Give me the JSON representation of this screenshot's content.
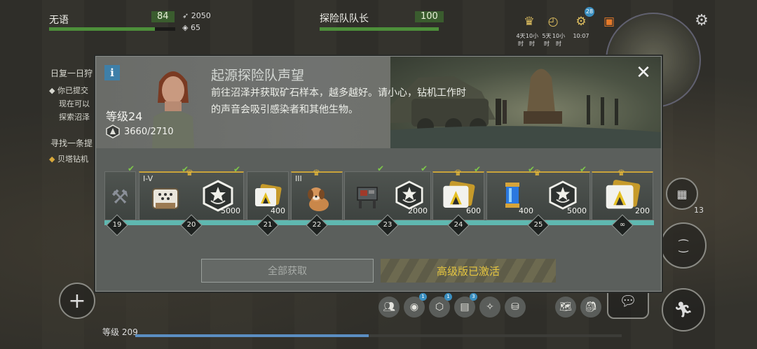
{
  "player": {
    "name": "无语",
    "hp": "84",
    "weapon_stat": "2050",
    "armor_stat": "65"
  },
  "squad": {
    "label": "探险队队长",
    "hp": "100"
  },
  "top_timers": [
    {
      "icon": "crown-icon",
      "label": "4天\n时"
    },
    {
      "icon": "clock-icon",
      "label": "10小\n时"
    },
    {
      "icon": "gear-badge-icon",
      "label": "5天\n时",
      "badge": "28"
    },
    {
      "icon": "chest-icon",
      "label": "10小\n时"
    },
    {
      "icon": "timer-icon",
      "label": "10:07"
    }
  ],
  "quests": {
    "daily_title": "日复一日狩",
    "daily_lines": [
      "你已提交",
      "现在可以",
      "探索沼泽"
    ],
    "find_title": "寻找一条提",
    "find_line": "贝塔钻机"
  },
  "modal": {
    "info": "i",
    "close": "✕",
    "title": "起源探险队声望",
    "description": "前往沼泽并获取矿石样本，越多越好。请小心，钻机工作时的声音会吸引感染者和其他生物。",
    "level": "等级24",
    "progress": "3660/2710",
    "claim_all": "全部获取",
    "premium_status": "高级版已激活"
  },
  "rewards": [
    {
      "level": "19",
      "item": "weapon-parts-icon",
      "count": "",
      "tier": "",
      "premium": false
    },
    {
      "level": "20",
      "item": "reward-crate-icon",
      "count": "",
      "tier": "I-V",
      "premium": true
    },
    {
      "level": "20",
      "item": "reputation-badge-icon",
      "count": "5000",
      "tier": "",
      "premium": true
    },
    {
      "level": "21",
      "item": "gold-card-icon",
      "count": "400",
      "tier": "",
      "premium": false
    },
    {
      "level": "22",
      "item": "dog-icon",
      "count": "",
      "tier": "III",
      "premium": true
    },
    {
      "level": "23",
      "item": "workbench-icon",
      "count": "",
      "tier": "",
      "premium": false
    },
    {
      "level": "23",
      "item": "reputation-badge-icon",
      "count": "2000",
      "tier": "",
      "premium": false
    },
    {
      "level": "24",
      "item": "gold-card-icon",
      "count": "600",
      "tier": "",
      "premium": true
    },
    {
      "level": "25",
      "item": "energy-capsule-icon",
      "count": "400",
      "tier": "",
      "premium": true
    },
    {
      "level": "25",
      "item": "reputation-badge-icon",
      "count": "5000",
      "tier": "",
      "premium": false
    },
    {
      "level": "∞",
      "item": "gold-card-icon",
      "count": "200",
      "tier": "",
      "premium": true
    }
  ],
  "right_hud": {
    "ammo": "13"
  },
  "bottom": {
    "level": "等级 209",
    "badges": [
      "1",
      "1",
      "3"
    ]
  },
  "colors": {
    "accent": "#5fb8b0",
    "check": "#7ec84a",
    "gold": "#e2b53a",
    "hp": "#4d8f3a"
  }
}
